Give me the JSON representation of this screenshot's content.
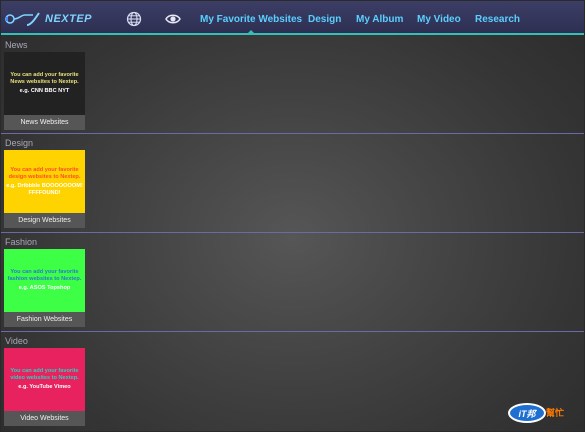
{
  "app": {
    "logo_text": "NEXTEP"
  },
  "toolbar": {
    "globe_icon": "globe-icon",
    "eye_icon": "eye-icon",
    "tabs": [
      {
        "label": "My Favorite Websites",
        "active": true
      },
      {
        "label": "Design",
        "active": false
      },
      {
        "label": "My Album",
        "active": false
      },
      {
        "label": "My Video",
        "active": false
      },
      {
        "label": "Research",
        "active": false
      }
    ],
    "accent_color": "#35c0b5",
    "tab_color": "#5ad0ff"
  },
  "sections": [
    {
      "title": "News",
      "tile": {
        "color": "#222222",
        "desc_color": "#e8e27a",
        "description": "You can add your favorite News websites to Nextep.",
        "example": "e.g. CNN BBC NYT",
        "example_color": "#ffffff",
        "label": "News Websites"
      }
    },
    {
      "title": "Design",
      "tile": {
        "color": "#ffd300",
        "desc_color": "#ff4a2a",
        "description": "You can add your favorite design websites to Nextep.",
        "example": "e.g. Dribbble BOOOOOOOM! FFFFOUND!",
        "example_color": "#ffffff",
        "label": "Design Websites"
      }
    },
    {
      "title": "Fashion",
      "tile": {
        "color": "#3cff46",
        "desc_color": "#2a7acc",
        "description": "You can add your favorite fashion websites to Nextep.",
        "example": "e.g. ASOS Topshop",
        "example_color": "#ffffff",
        "label": "Fashion Websites"
      }
    },
    {
      "title": "Video",
      "tile": {
        "color": "#e8225e",
        "desc_color": "#2ad0c0",
        "description": "You can add your favorite video websites to Nextep.",
        "example": "e.g. YouTube Vimeo",
        "example_color": "#ffffff",
        "label": "Video Websites"
      }
    }
  ],
  "watermark": {
    "left_text": "iT邦",
    "right_text": "幫忙"
  }
}
